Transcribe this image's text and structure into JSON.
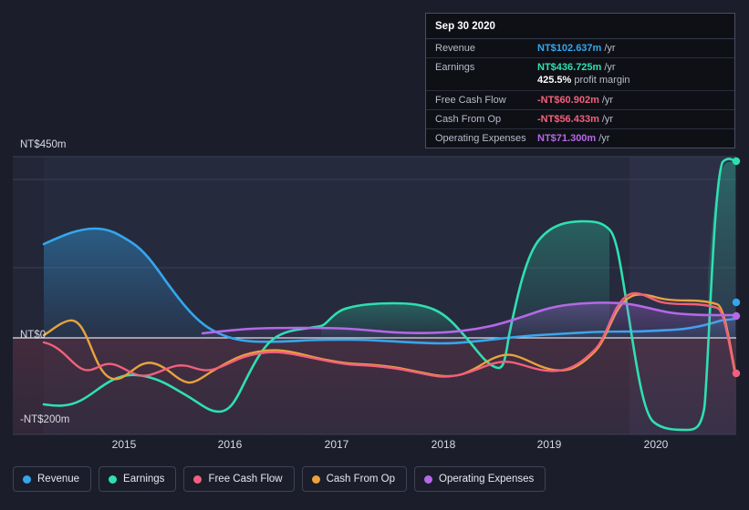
{
  "tooltip": {
    "date": "Sep 30 2020",
    "rows": [
      {
        "label": "Revenue",
        "value": "NT$102.637m",
        "unit": "/yr",
        "color": "#33a7ee"
      },
      {
        "label": "Earnings",
        "value": "NT$436.725m",
        "unit": "/yr",
        "color": "#2ee0b0"
      },
      {
        "label": "Free Cash Flow",
        "value": "-NT$60.902m",
        "unit": "/yr",
        "color": "#f2607b"
      },
      {
        "label": "Cash From Op",
        "value": "-NT$56.433m",
        "unit": "/yr",
        "color": "#f2607b"
      },
      {
        "label": "Operating Expenses",
        "value": "NT$71.300m",
        "unit": "/yr",
        "color": "#b668e8"
      }
    ],
    "margin_value": "425.5%",
    "margin_label": "profit margin"
  },
  "axis": {
    "y_labels": [
      "NT$450m",
      "NT$0",
      "-NT$200m"
    ],
    "x_labels": [
      "2015",
      "2016",
      "2017",
      "2018",
      "2019",
      "2020"
    ]
  },
  "legend": [
    {
      "label": "Revenue",
      "color": "#33a7ee"
    },
    {
      "label": "Earnings",
      "color": "#2ee0b0"
    },
    {
      "label": "Free Cash Flow",
      "color": "#f2607b"
    },
    {
      "label": "Cash From Op",
      "color": "#e8a33d"
    },
    {
      "label": "Operating Expenses",
      "color": "#b668e8"
    }
  ],
  "chart_data": {
    "type": "area",
    "title": "",
    "xlabel": "",
    "ylabel": "",
    "ylim": [
      -200,
      450
    ],
    "y_unit": "NT$m",
    "grid": true,
    "legend_position": "bottom",
    "x_tick_labels": [
      "2015",
      "2016",
      "2017",
      "2018",
      "2019",
      "2020"
    ],
    "x": [
      2014.3,
      2014.6,
      2014.9,
      2015.15,
      2015.4,
      2015.65,
      2015.9,
      2016.15,
      2016.4,
      2016.65,
      2016.9,
      2017.15,
      2017.4,
      2017.65,
      2017.9,
      2018.15,
      2018.4,
      2018.65,
      2018.9,
      2019.15,
      2019.4,
      2019.65,
      2019.9,
      2020.15,
      2020.4,
      2020.75
    ],
    "series": [
      {
        "name": "Revenue",
        "color": "#33a7ee",
        "values": [
          160,
          178,
          188,
          175,
          172,
          150,
          100,
          42,
          12,
          -5,
          -12,
          -13,
          -12,
          -13,
          -14,
          -14,
          -15,
          -12,
          -8,
          -4,
          0,
          3,
          5,
          5,
          12,
          103
        ]
      },
      {
        "name": "Earnings",
        "color": "#2ee0b0",
        "values": [
          -175,
          -168,
          -150,
          -140,
          -135,
          -128,
          -150,
          -175,
          -130,
          -55,
          62,
          75,
          72,
          65,
          40,
          -20,
          -55,
          -70,
          -40,
          185,
          215,
          218,
          150,
          -190,
          -205,
          437
        ]
      },
      {
        "name": "Free Cash Flow",
        "color": "#f2607b",
        "values": [
          -10,
          -12,
          -60,
          -80,
          -60,
          -72,
          -80,
          -72,
          -62,
          -40,
          -30,
          -32,
          -38,
          -40,
          -45,
          -48,
          -52,
          -60,
          -72,
          -70,
          -55,
          -20,
          48,
          55,
          52,
          -61
        ]
      },
      {
        "name": "Cash From Op",
        "color": "#e8a33d",
        "values": [
          10,
          35,
          -55,
          -72,
          -58,
          -70,
          -78,
          -68,
          -55,
          -35,
          -28,
          -30,
          -35,
          -38,
          -42,
          -45,
          -50,
          -58,
          -70,
          -65,
          -48,
          -8,
          62,
          60,
          52,
          -56
        ]
      },
      {
        "name": "Operating Expenses",
        "color": "#b668e8",
        "values": [
          null,
          null,
          null,
          null,
          null,
          8,
          10,
          12,
          14,
          16,
          18,
          20,
          18,
          15,
          12,
          10,
          12,
          18,
          28,
          40,
          50,
          52,
          50,
          48,
          46,
          71
        ]
      }
    ]
  }
}
